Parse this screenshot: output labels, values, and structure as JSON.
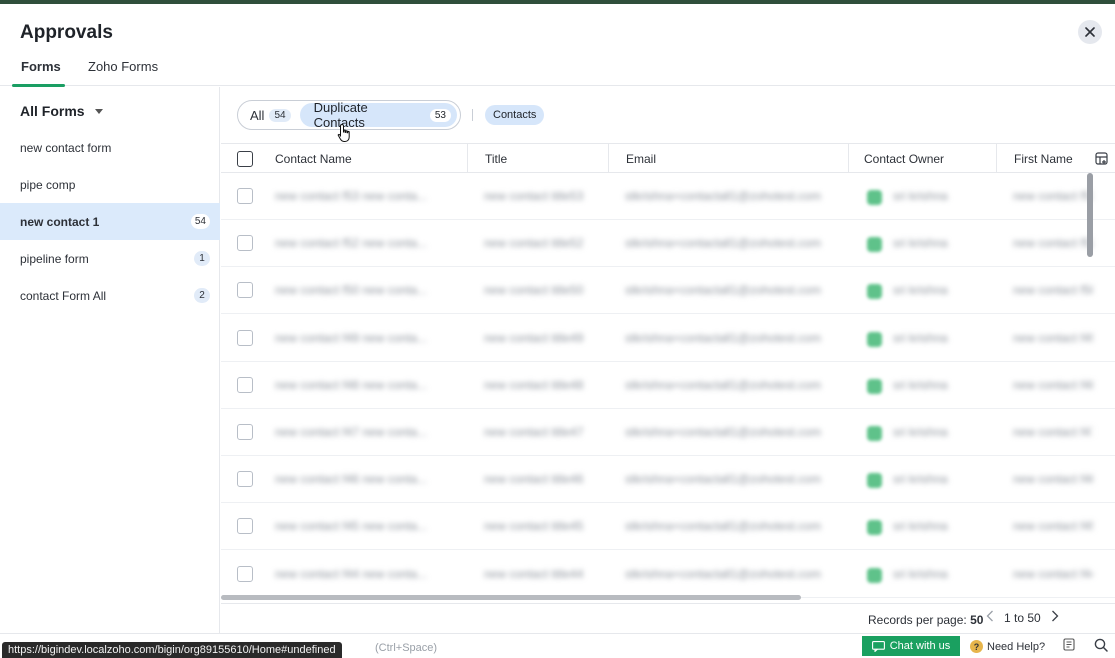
{
  "header": {
    "title": "Approvals",
    "tabs": [
      {
        "label": "Forms",
        "active": true
      },
      {
        "label": "Zoho Forms",
        "active": false
      }
    ]
  },
  "sidebar": {
    "title": "All Forms",
    "items": [
      {
        "label": "new contact form",
        "count": ""
      },
      {
        "label": "pipe comp",
        "count": ""
      },
      {
        "label": "new contact 1",
        "count": "54",
        "active": true
      },
      {
        "label": "pipeline form",
        "count": "1"
      },
      {
        "label": "contact Form All",
        "count": "2"
      }
    ]
  },
  "filters": {
    "all_label": "All",
    "all_count": "54",
    "dup_label": "Duplicate Contacts",
    "dup_count": "53",
    "module_chip": "Contacts"
  },
  "table": {
    "columns": [
      "Contact Name",
      "Title",
      "Email",
      "Contact Owner",
      "First Name"
    ],
    "rows": [
      {
        "name": "new contact f53 new conta...",
        "title": "new contact title53",
        "email": "stkrishna+contactall1@zohotest.com",
        "owner": "sri krishna",
        "first": "new contact f53"
      },
      {
        "name": "new contact f52 new conta...",
        "title": "new contact title52",
        "email": "stkrishna+contactall1@zohotest.com",
        "owner": "sri krishna",
        "first": "new contact f52"
      },
      {
        "name": "new contact f50 new conta...",
        "title": "new contact title50",
        "email": "stkrishna+contactall1@zohotest.com",
        "owner": "sri krishna",
        "first": "new contact f50"
      },
      {
        "name": "new contact f49 new conta...",
        "title": "new contact title49",
        "email": "stkrishna+contactall1@zohotest.com",
        "owner": "sri krishna",
        "first": "new contact f49"
      },
      {
        "name": "new contact f48 new conta...",
        "title": "new contact title48",
        "email": "stkrishna+contactall1@zohotest.com",
        "owner": "sri krishna",
        "first": "new contact f48"
      },
      {
        "name": "new contact f47 new conta...",
        "title": "new contact title47",
        "email": "stkrishna+contactall1@zohotest.com",
        "owner": "sri krishna",
        "first": "new contact f47"
      },
      {
        "name": "new contact f46 new conta...",
        "title": "new contact title46",
        "email": "stkrishna+contactall1@zohotest.com",
        "owner": "sri krishna",
        "first": "new contact f46"
      },
      {
        "name": "new contact f45 new conta...",
        "title": "new contact title45",
        "email": "stkrishna+contactall1@zohotest.com",
        "owner": "sri krishna",
        "first": "new contact f45"
      },
      {
        "name": "new contact f44 new conta...",
        "title": "new contact title44",
        "email": "stkrishna+contactall1@zohotest.com",
        "owner": "sri krishna",
        "first": "new contact f44"
      }
    ]
  },
  "footer": {
    "per_page_label": "Records per page:",
    "per_page_value": "50",
    "range": "1 to 50"
  },
  "bottombar": {
    "url": "https://bigindev.localzoho.com/bigin/org89155610/Home#undefined",
    "hint": "(Ctrl+Space)",
    "chat_label": "Chat with us",
    "help_label": "Need Help?"
  },
  "colors": {
    "accent_green": "#1aa060",
    "selected_blue": "#dbeafb",
    "chip_blue": "#d6e6fa"
  },
  "icons": [
    "close-icon",
    "caret-down-icon",
    "hand-cursor-icon",
    "column-settings-icon",
    "chevron-left-icon",
    "chevron-right-icon",
    "chat-icon",
    "help-icon",
    "notes-icon",
    "search-icon"
  ]
}
